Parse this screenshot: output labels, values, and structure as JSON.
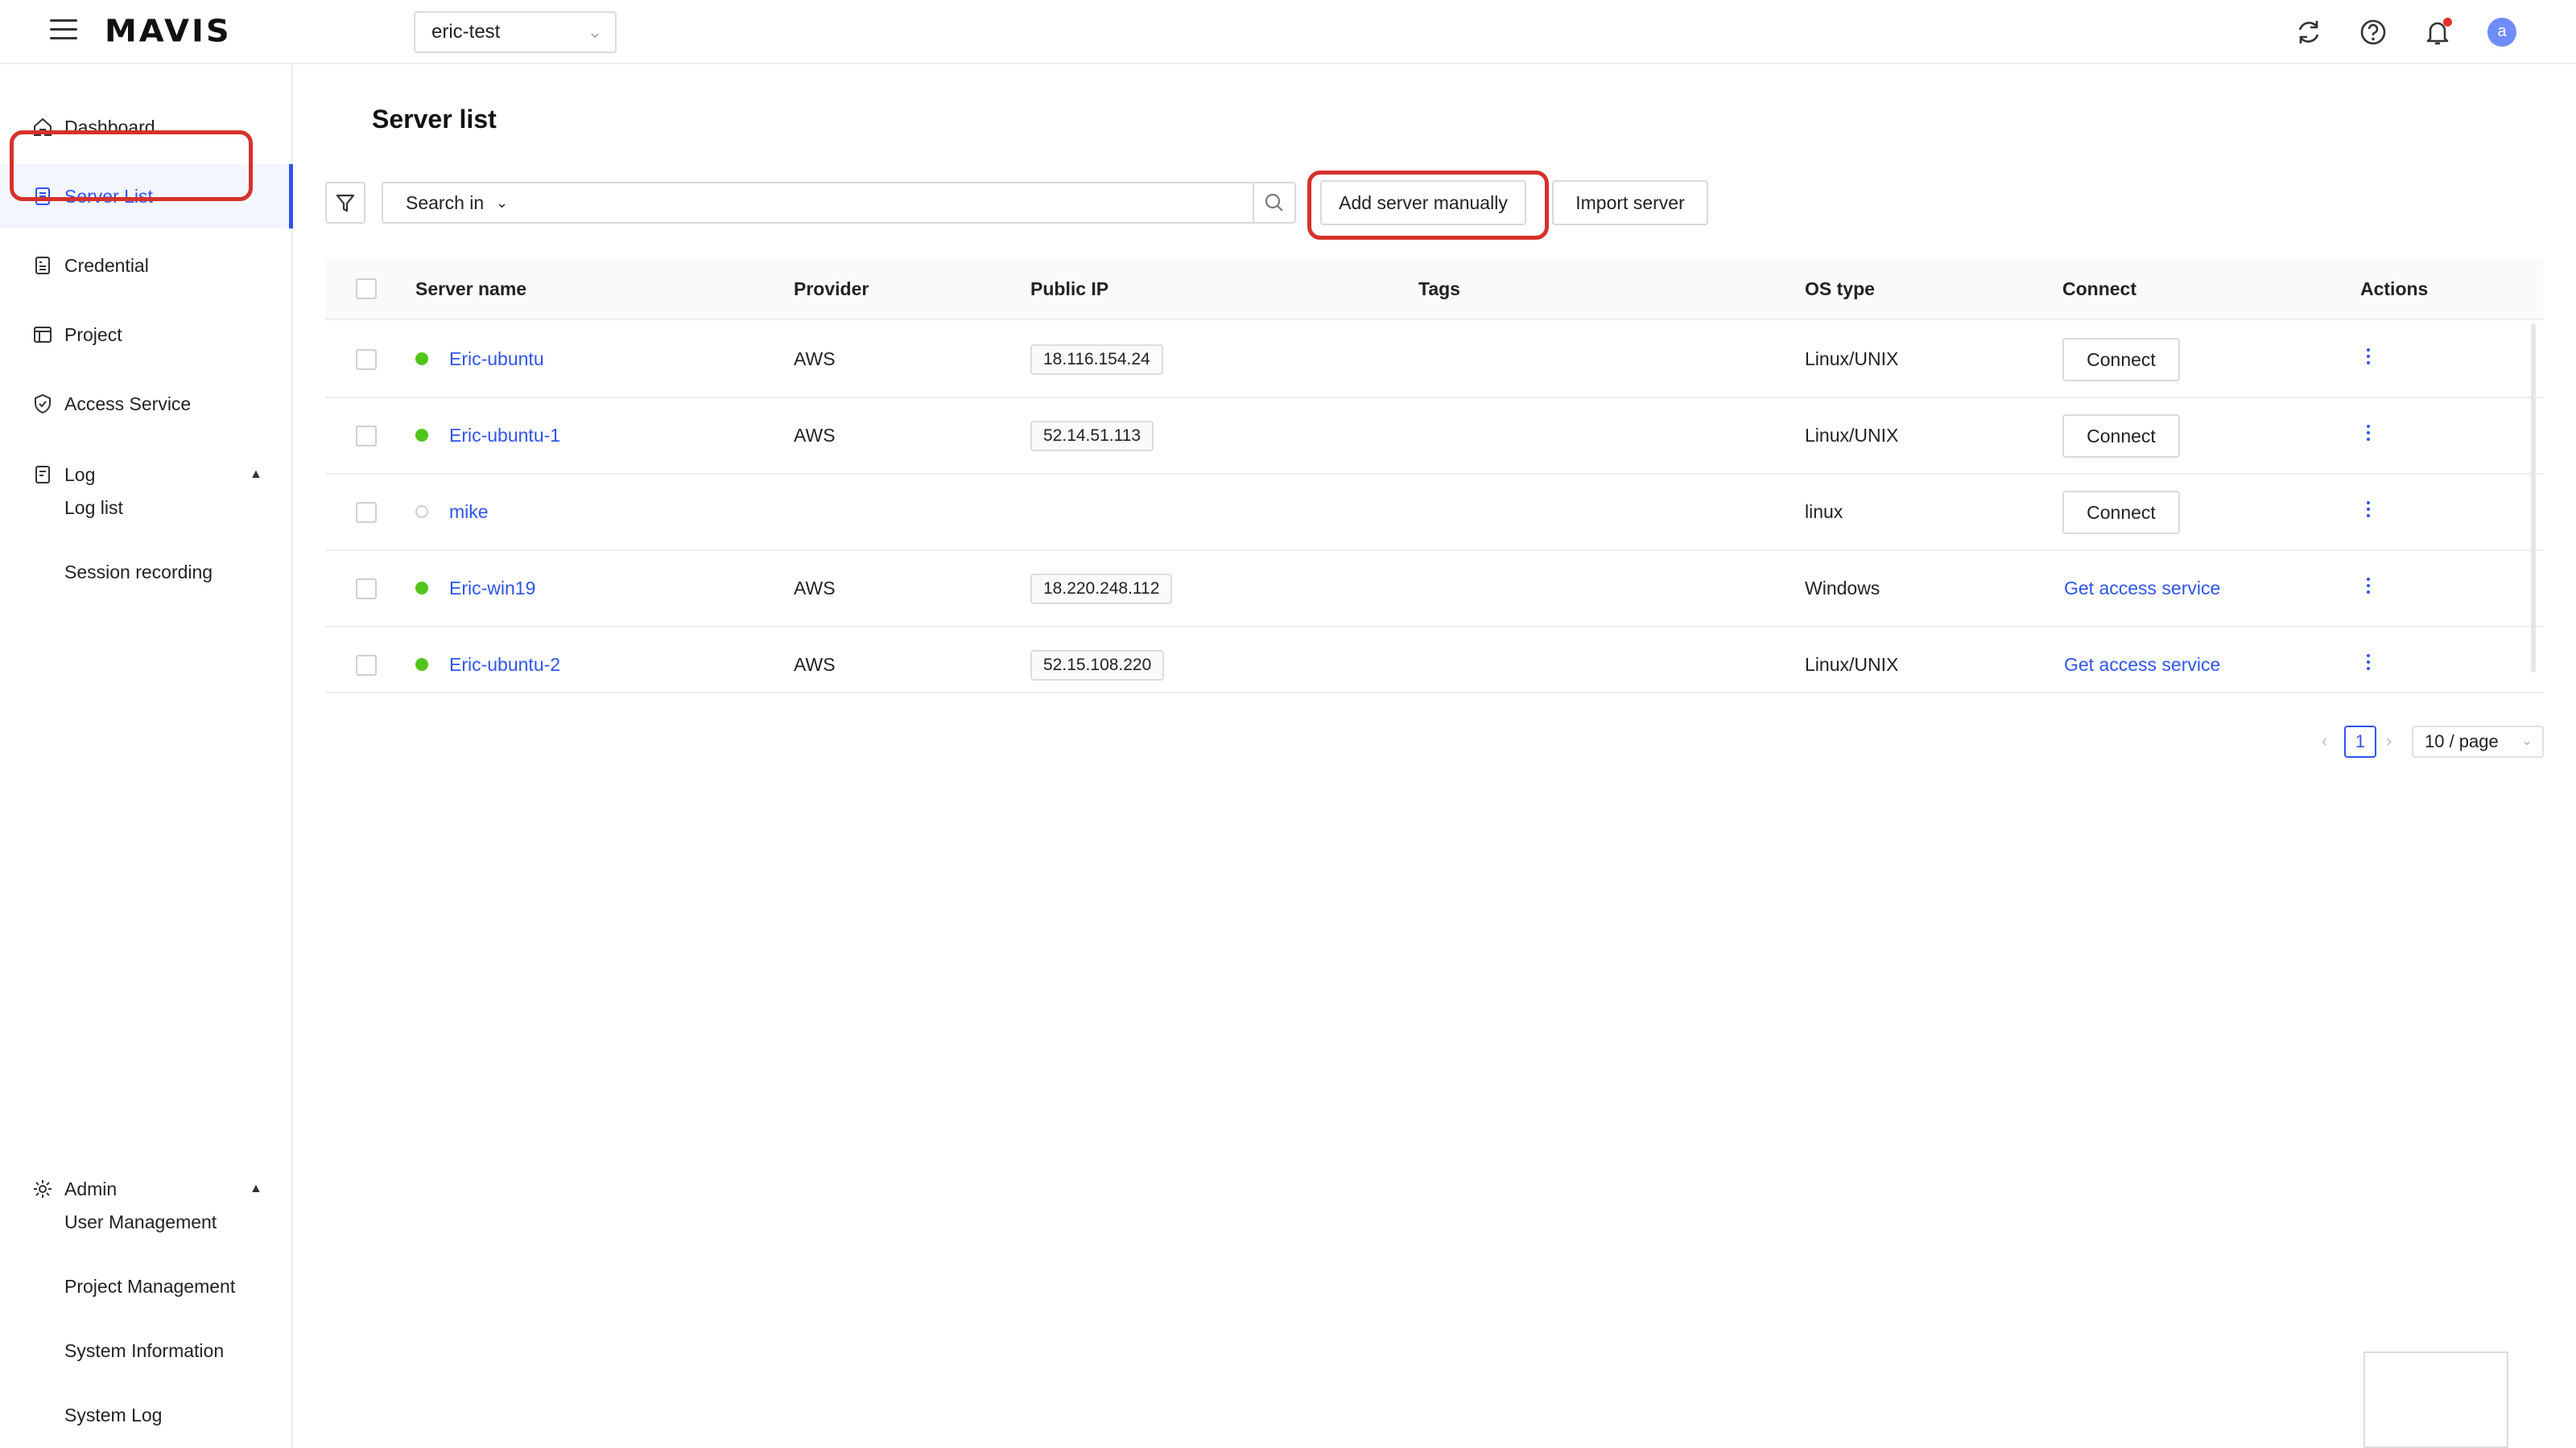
{
  "header": {
    "logo": "MAVIS",
    "project": "eric-test"
  },
  "sidebar": {
    "items": [
      {
        "label": "Dashboard"
      },
      {
        "label": "Server List"
      },
      {
        "label": "Credential"
      },
      {
        "label": "Project"
      },
      {
        "label": "Access Service"
      },
      {
        "label": "Log"
      }
    ],
    "log_sub": [
      "Log list",
      "Session recording"
    ],
    "admin": {
      "label": "Admin",
      "sub": [
        "User Management",
        "Project Management",
        "System Information",
        "System Log"
      ]
    }
  },
  "main": {
    "title": "Server list",
    "search_in": "Search in",
    "search_placeholder": "",
    "add_manual": "Add server manually",
    "import_server": "Import server"
  },
  "table": {
    "headers": [
      "Server name",
      "Provider",
      "Public IP",
      "Tags",
      "OS type",
      "Connect",
      "Actions"
    ],
    "rows": [
      {
        "name": "Eric-ubuntu",
        "provider": "AWS",
        "ip": "18.116.154.24",
        "os": "Linux/UNIX",
        "connect": "Connect",
        "status": "online"
      },
      {
        "name": "Eric-ubuntu-1",
        "provider": "AWS",
        "ip": "52.14.51.113",
        "os": "Linux/UNIX",
        "connect": "Connect",
        "status": "online"
      },
      {
        "name": "mike",
        "provider": "",
        "ip": "",
        "os": "linux",
        "connect": "Connect",
        "status": "unknown"
      },
      {
        "name": "Eric-win19",
        "provider": "AWS",
        "ip": "18.220.248.112",
        "os": "Windows",
        "connect": "Get access service",
        "status": "online"
      },
      {
        "name": "Eric-ubuntu-2",
        "provider": "AWS",
        "ip": "52.15.108.220",
        "os": "Linux/UNIX",
        "connect": "Get access service",
        "status": "online"
      }
    ]
  },
  "pagination": {
    "page": "1",
    "page_size": "10 / page"
  },
  "colors": {
    "accent": "#2f54eb",
    "status_online": "#52c41a",
    "highlight": "#d6312b"
  }
}
